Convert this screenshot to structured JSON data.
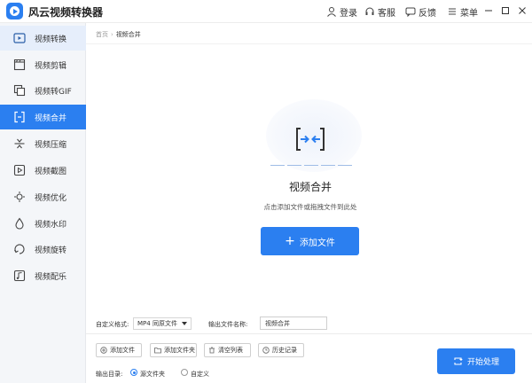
{
  "app": {
    "title": "风云视频转换器"
  },
  "toolbar": {
    "login": "登录",
    "service": "客服",
    "feedback": "反馈",
    "menu": "菜单"
  },
  "sidebar": {
    "items": [
      {
        "label": "视频转换",
        "icon": "video-convert-icon"
      },
      {
        "label": "视频剪辑",
        "icon": "clapperboard-icon"
      },
      {
        "label": "视频转GIF",
        "icon": "gif-icon"
      },
      {
        "label": "视频合并",
        "icon": "merge-icon"
      },
      {
        "label": "视频压缩",
        "icon": "compress-icon"
      },
      {
        "label": "视频截图",
        "icon": "screenshot-icon"
      },
      {
        "label": "视频优化",
        "icon": "optimize-icon"
      },
      {
        "label": "视频水印",
        "icon": "watermark-icon"
      },
      {
        "label": "视频旋转",
        "icon": "rotate-icon"
      },
      {
        "label": "视频配乐",
        "icon": "music-icon"
      }
    ],
    "active_index": 3
  },
  "breadcrumb": {
    "home": "首页",
    "current": "视频合并"
  },
  "main": {
    "title": "视频合并",
    "subtitle": "点击添加文件或拖拽文件到此处",
    "add_file_label": "添加文件"
  },
  "settings": {
    "format_label": "自定义格式:",
    "format_value": "MP4 同原文件",
    "output_name_label": "输出文件名称:",
    "output_name_value": "视频合并"
  },
  "actions": {
    "add_file": "添加文件",
    "add_folder": "添加文件夹",
    "clear_list": "清空列表",
    "history": "历史记录"
  },
  "output": {
    "label": "输出目录:",
    "option_source": "源文件夹",
    "option_custom": "自定义",
    "selected": "源文件夹"
  },
  "start_label": "开始处理",
  "colors": {
    "accent": "#2b7ff0",
    "sidebar_bg": "#f4f6f9"
  }
}
